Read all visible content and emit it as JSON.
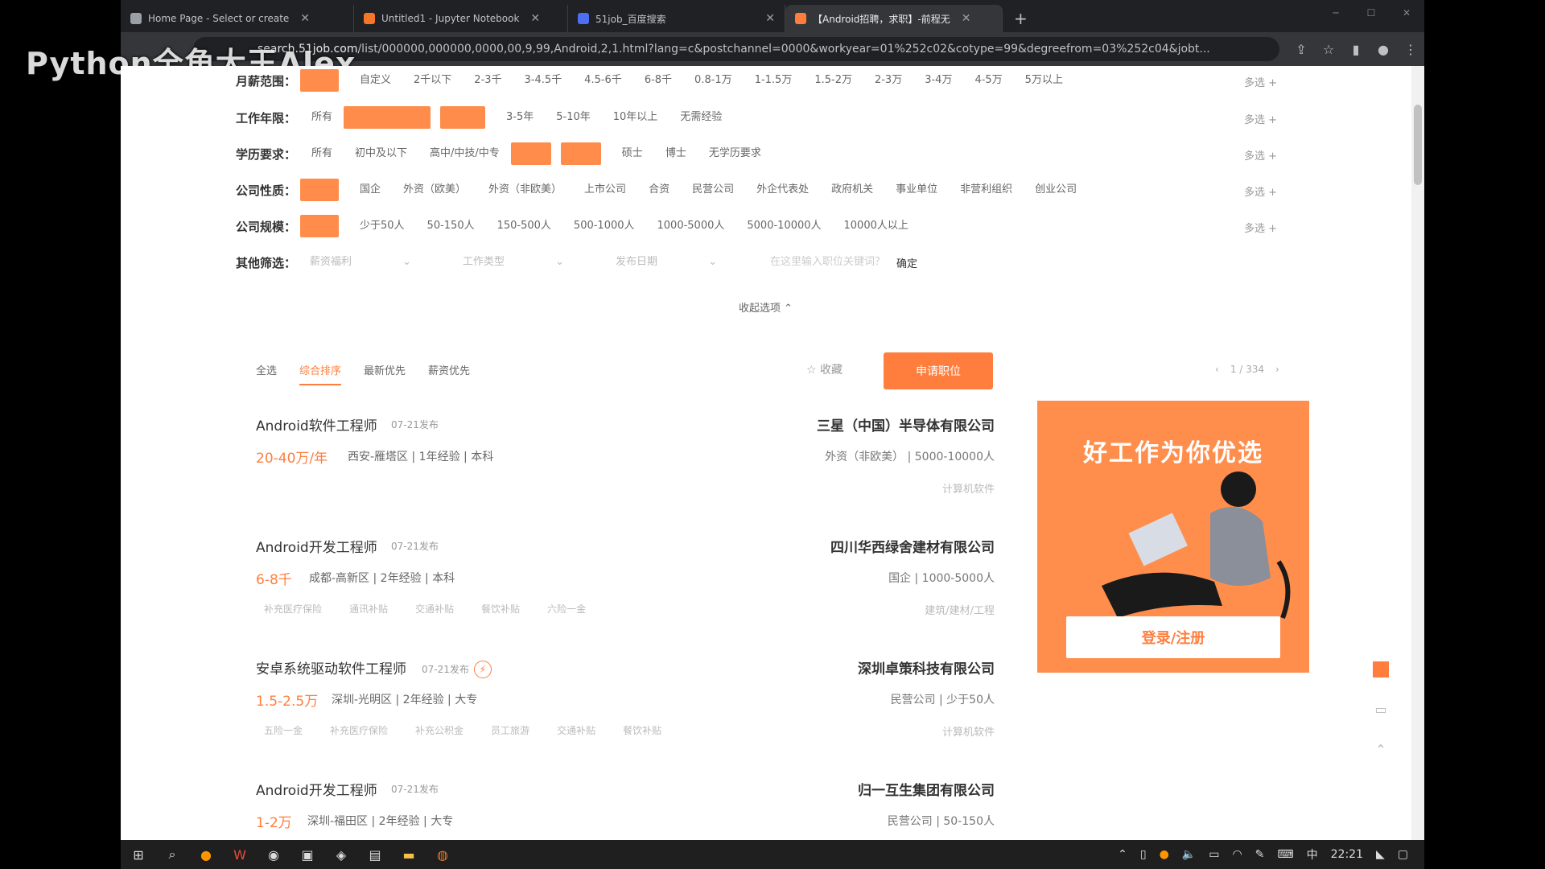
{
  "browser": {
    "tabs": [
      {
        "title": "Home Page - Select or create"
      },
      {
        "title": "Untitled1 - Jupyter Notebook"
      },
      {
        "title": "51job_百度搜索"
      },
      {
        "title": "【Android招聘，求职】-前程无"
      }
    ],
    "url_host": "search.51job.com",
    "url_path": "/list/000000,000000,0000,00,9,99,Android,2,1.html?lang=c&postchannel=0000&workyear=01%252c02&cotype=99&degreefrom=03%252c04&jobt..."
  },
  "watermark": "Python全角大王Alex",
  "filters": {
    "salary": {
      "label": "月薪范围：",
      "options": [
        "自定义",
        "2千以下",
        "2-3千",
        "3-4.5千",
        "4.5-6千",
        "6-8千",
        "0.8-1万",
        "1-1.5万",
        "1.5-2万",
        "2-3万",
        "3-4万",
        "4-5万",
        "5万以上"
      ],
      "more": "多选 +"
    },
    "workyear": {
      "label": "工作年限：",
      "options": [
        "所有",
        "3-5年",
        "5-10年",
        "10年以上",
        "无需经验"
      ],
      "more": "多选 +"
    },
    "degree": {
      "label": "学历要求：",
      "options": [
        "所有",
        "初中及以下",
        "高中/中技/中专",
        "硕士",
        "博士",
        "无学历要求"
      ],
      "more": "多选 +"
    },
    "cotype": {
      "label": "公司性质：",
      "options": [
        "国企",
        "外资（欧美）",
        "外资（非欧美）",
        "上市公司",
        "合资",
        "民营公司",
        "外企代表处",
        "政府机关",
        "事业单位",
        "非营利组织",
        "创业公司"
      ],
      "more": "多选 +"
    },
    "cosize": {
      "label": "公司规模：",
      "options": [
        "少于50人",
        "50-150人",
        "150-500人",
        "500-1000人",
        "1000-5000人",
        "5000-10000人",
        "10000人以上"
      ],
      "more": "多选 +"
    },
    "other": {
      "label": "其他筛选：",
      "dropdowns": [
        "薪资福利",
        "工作类型",
        "发布日期"
      ],
      "extra": "在这里输入职位关键词？",
      "confirm": "确定"
    },
    "collapse": "收起选项 ⌃"
  },
  "sortbar": {
    "tabs": [
      "全选",
      "综合排序",
      "最新优先",
      "薪资优先"
    ],
    "active": 1,
    "favorite": "收藏",
    "apply": "申请职位",
    "pager": "1 / 334"
  },
  "jobs": [
    {
      "title": "Android软件工程师",
      "date": "07-21发布",
      "salary": "20-40万/年",
      "info": "西安-雁塔区 | 1年经验 | 本科",
      "tags": [],
      "company": "三星（中国）半导体有限公司",
      "company_info": "外资（非欧美） | 5000-10000人",
      "industry": "计算机软件"
    },
    {
      "title": "Android开发工程师",
      "date": "07-21发布",
      "salary": "6-8千",
      "info": "成都-高新区 | 2年经验 | 本科",
      "tags": [
        "补充医疗保险",
        "通讯补贴",
        "交通补贴",
        "餐饮补贴",
        "六险一金"
      ],
      "company": "四川华西绿舍建材有限公司",
      "company_info": "国企 | 1000-5000人",
      "industry": "建筑/建材/工程"
    },
    {
      "title": "安卓系统驱动软件工程师",
      "date": "07-21发布",
      "salary": "1.5-2.5万",
      "info": "深圳-光明区 | 2年经验 | 大专",
      "tags": [
        "五险一金",
        "补充医疗保险",
        "补充公积金",
        "员工旅游",
        "交通补贴",
        "餐饮补贴"
      ],
      "company": "深圳卓策科技有限公司",
      "company_info": "民营公司 | 少于50人",
      "industry": "计算机软件"
    },
    {
      "title": "Android开发工程师",
      "date": "07-21发布",
      "salary": "1-2万",
      "info": "深圳-福田区 | 2年经验 | 大专",
      "tags": [],
      "company": "归一互生集团有限公司",
      "company_info": "民营公司 | 50-150人",
      "industry": ""
    }
  ],
  "ad": {
    "title": "好工作为你优选",
    "login": "登录/注册"
  },
  "taskbar": {
    "time": "22:21",
    "ime": "中"
  },
  "colors": {
    "accent": "#ff7e3e",
    "chip": "#ff8c4a"
  }
}
